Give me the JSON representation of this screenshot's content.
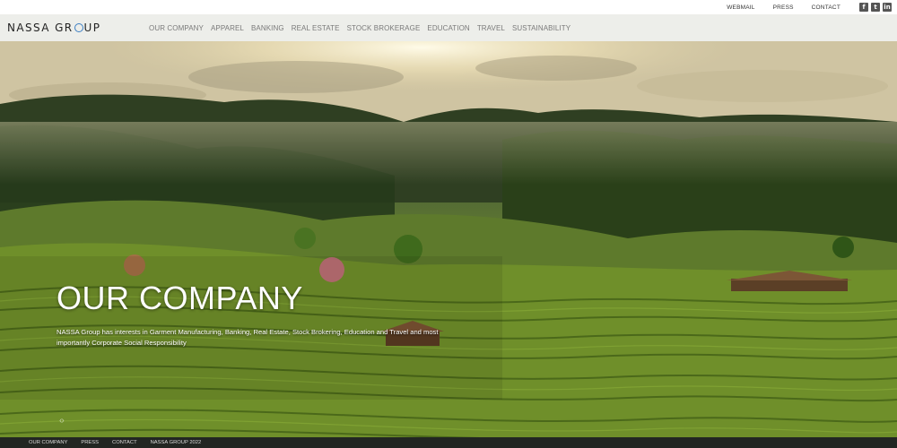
{
  "utility": {
    "links": [
      "WEBMAIL",
      "PRESS",
      "CONTACT"
    ],
    "social": [
      {
        "icon": "facebook-icon",
        "glyph": "f"
      },
      {
        "icon": "twitter-icon",
        "glyph": "t"
      },
      {
        "icon": "linkedin-icon",
        "glyph": "in"
      }
    ]
  },
  "header": {
    "logo_part1": "NASSA GR",
    "logo_part2": "UP",
    "logo_accent": "#3b7ec2",
    "nav": [
      "OUR COMPANY",
      "APPAREL",
      "BANKING",
      "REAL ESTATE",
      "STOCK BROKERAGE",
      "EDUCATION",
      "TRAVEL",
      "SUSTAINABILITY"
    ]
  },
  "hero": {
    "title": "OUR COMPANY",
    "description": "NASSA Group has interests in Garment Manufacturing, Banking, Real Estate, Stock Brokering, Education and Travel and most importantly Corporate Social Responsibility",
    "arrows": "‹›"
  },
  "footer": {
    "links": [
      "OUR COMPANY",
      "PRESS",
      "CONTACT",
      "NASSA GROUP 2022"
    ]
  }
}
